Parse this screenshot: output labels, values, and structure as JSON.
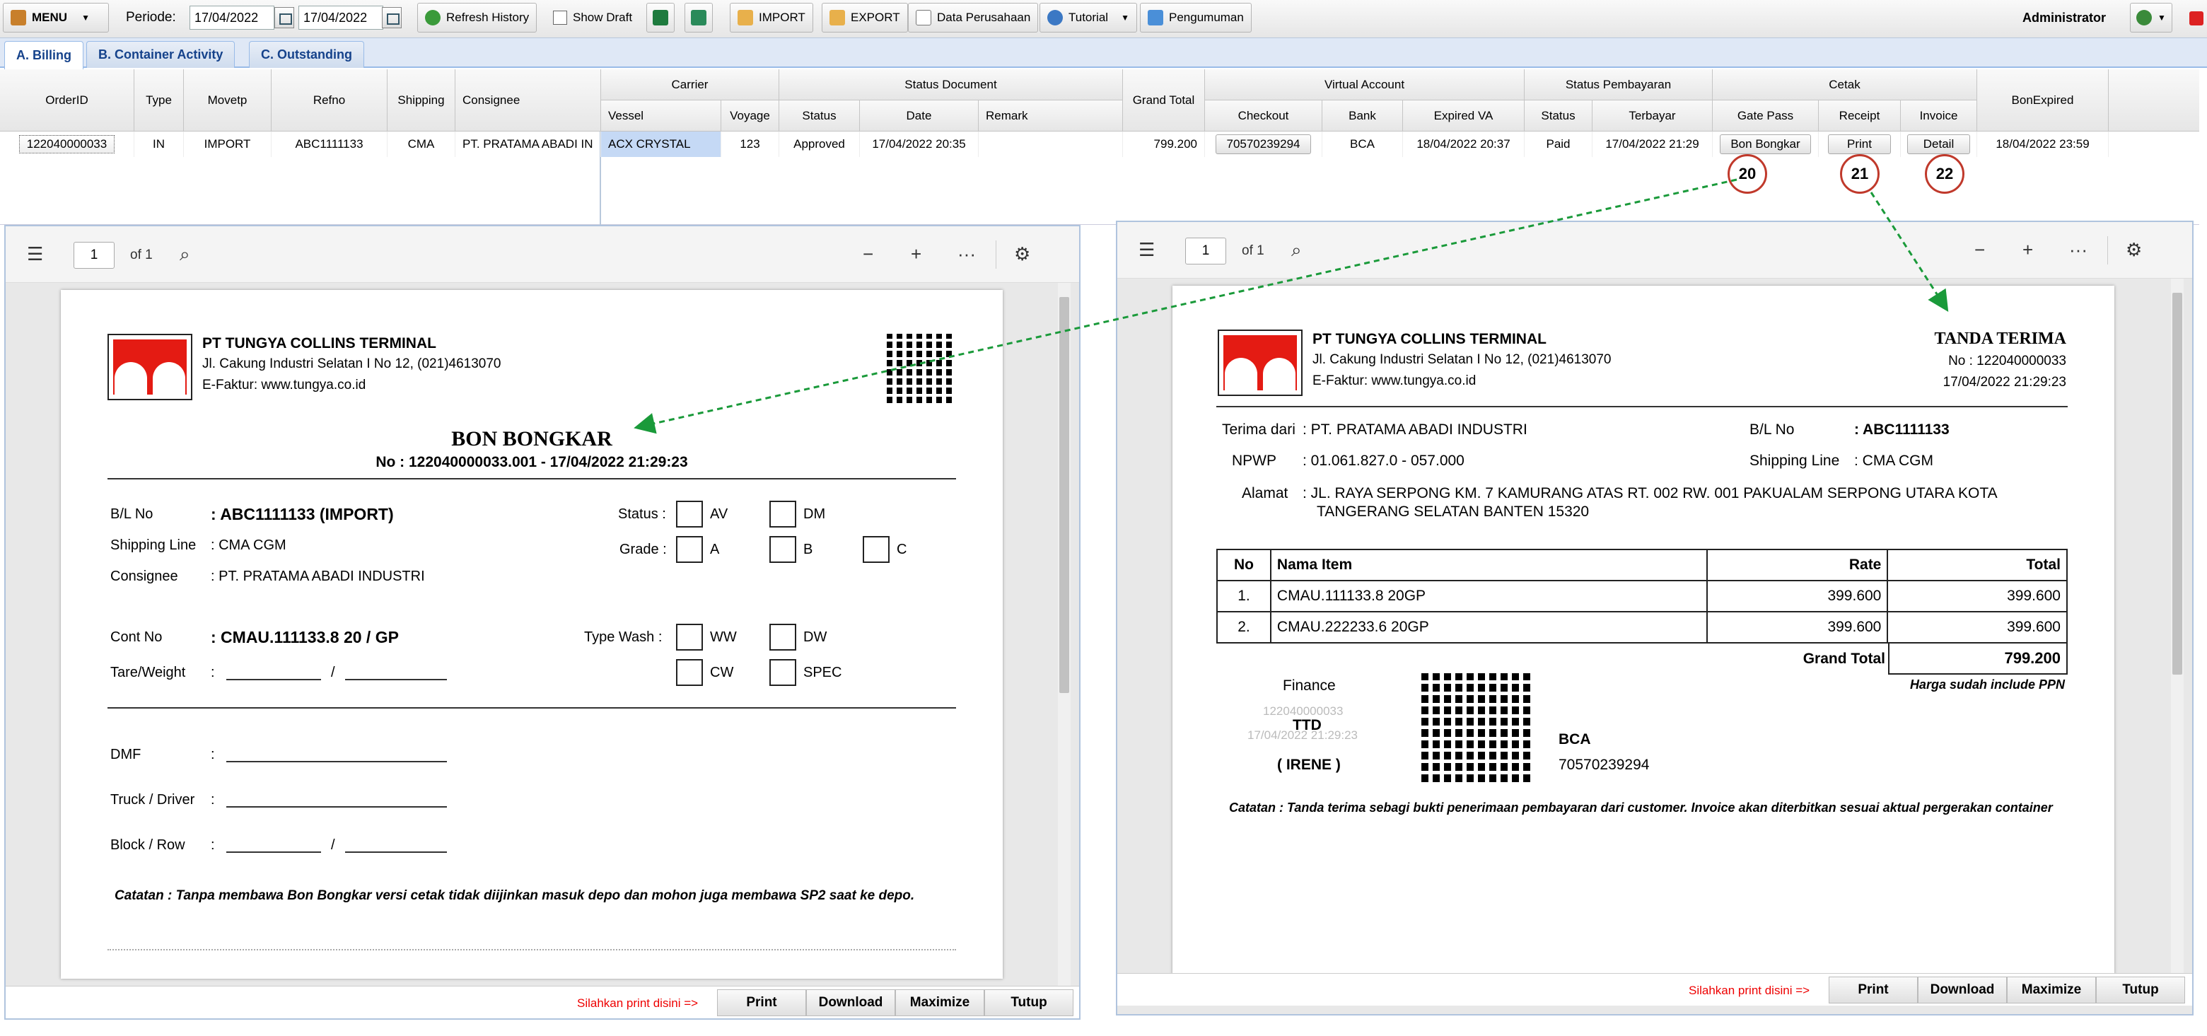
{
  "toolbar": {
    "menu_label": "MENU",
    "periode_label": "Periode:",
    "date_from": "17/04/2022",
    "date_to": "17/04/2022",
    "refresh_label": "Refresh History",
    "show_draft_label": "Show Draft",
    "import_label": "IMPORT",
    "export_label": "EXPORT",
    "data_perusahaan_label": "Data Perusahaan",
    "tutorial_label": "Tutorial",
    "pengumuman_label": "Pengumuman",
    "user_label": "Administrator"
  },
  "tabs": [
    "A. Billing",
    "B. Container Activity",
    "C. Outstanding"
  ],
  "grid": {
    "headers": {
      "orderid": "OrderID",
      "type": "Type",
      "movetp": "Movetp",
      "refno": "Refno",
      "shipping": "Shipping",
      "consignee": "Consignee",
      "carrier": "Carrier",
      "vessel": "Vessel",
      "voyage": "Voyage",
      "status_document": "Status Document",
      "status": "Status",
      "date": "Date",
      "remark": "Remark",
      "grand_total": "Grand Total",
      "virtual_account": "Virtual Account",
      "checkout": "Checkout",
      "bank": "Bank",
      "expired_va": "Expired VA",
      "status_pembayaran": "Status Pembayaran",
      "sp_status": "Status",
      "terbayar": "Terbayar",
      "cetak": "Cetak",
      "gate_pass": "Gate Pass",
      "receipt": "Receipt",
      "invoice": "Invoice",
      "bon_expired": "BonExpired"
    },
    "row": {
      "orderid": "122040000033",
      "type": "IN",
      "movetp": "IMPORT",
      "refno": "ABC1111133",
      "shipping": "CMA",
      "consignee": "PT. PRATAMA ABADI IN",
      "vessel": "ACX CRYSTAL",
      "voyage": "123",
      "status": "Approved",
      "date": "17/04/2022 20:35",
      "remark": "",
      "grand_total": "799.200",
      "checkout": "70570239294",
      "bank": "BCA",
      "expired_va": "18/04/2022 20:37",
      "sp_status": "Paid",
      "terbayar": "17/04/2022 21:29",
      "gate_pass": "Bon Bongkar",
      "receipt": "Print",
      "invoice": "Detail",
      "bon_expired": "18/04/2022 23:59"
    },
    "callouts": [
      "20",
      "21",
      "22"
    ]
  },
  "viewer_left": {
    "page": "1",
    "of": "of 1",
    "company": "PT TUNGYA COLLINS TERMINAL",
    "address": "Jl. Cakung Industri Selatan I No 12, (021)4613070",
    "efaktur": "E-Faktur: www.tungya.co.id",
    "title": "BON BONGKAR",
    "number": "No : 122040000033.001  -  17/04/2022 21:29:23",
    "bl_label": "B/L No",
    "bl_value": ": ABC1111133 (IMPORT)",
    "shipping_label": "Shipping Line",
    "shipping_value": ":  CMA CGM",
    "consignee_label": "Consignee",
    "consignee_value": ":  PT. PRATAMA ABADI INDUSTRI",
    "status_label": "Status :",
    "status_opts": [
      "AV",
      "DM"
    ],
    "grade_label": "Grade :",
    "grade_opts": [
      "A",
      "B",
      "C"
    ],
    "cont_label": "Cont No",
    "cont_value": ": CMAU.111133.8  20 / GP",
    "tare_label": "Tare/Weight",
    "colon": ":",
    "slash": "/",
    "typewash_label": "Type Wash :",
    "wash_opts": [
      "WW",
      "DW",
      "CW",
      "SPEC"
    ],
    "dmf_label": "DMF",
    "truck_label": "Truck / Driver",
    "block_label": "Block / Row",
    "catatan": "Catatan : Tanpa membawa Bon Bongkar versi cetak tidak diijinkan masuk depo dan mohon juga membawa SP2 saat ke depo.",
    "hint": "Silahkan print disini =>",
    "buttons": [
      "Print",
      "Download",
      "Maximize",
      "Tutup"
    ]
  },
  "viewer_right": {
    "page": "1",
    "of": "of 1",
    "company": "PT TUNGYA COLLINS TERMINAL",
    "address": "Jl. Cakung Industri Selatan I No 12, (021)4613070",
    "efaktur": "E-Faktur: www.tungya.co.id",
    "title": "TANDA TERIMA",
    "no": "No : 122040000033",
    "datetime": "17/04/2022 21:29:23",
    "terima_label": "Terima dari",
    "terima_value": ":  PT. PRATAMA ABADI INDUSTRI",
    "npwp_label": "NPWP",
    "npwp_value": ":  01.061.827.0 - 057.000",
    "alamat_label": "Alamat",
    "alamat_line1": ":  JL. RAYA SERPONG KM. 7 KAMURANG ATAS RT. 002 RW. 001 PAKUALAM SERPONG UTARA KOTA",
    "alamat_line2": "TANGERANG  SELATAN BANTEN 15320",
    "bl_label": "B/L No",
    "bl_value": ":  ABC1111133",
    "shipping_label": "Shipping Line",
    "shipping_value": ":  CMA CGM",
    "table_headers": [
      "No",
      "Nama Item",
      "Rate",
      "Total"
    ],
    "items": [
      {
        "no": "1.",
        "name": "CMAU.111133.8 20GP",
        "rate": "399.600",
        "total": "399.600"
      },
      {
        "no": "2.",
        "name": "CMAU.222233.6 20GP",
        "rate": "399.600",
        "total": "399.600"
      }
    ],
    "grand_total_label": "Grand Total",
    "grand_total": "799.200",
    "ppn_note": "Harga sudah include PPN",
    "finance": "Finance",
    "stamp_no": "122040000033",
    "stamp_date": "17/04/2022 21:29:23",
    "ttd": "TTD",
    "signer": "( IRENE )",
    "bank": "BCA",
    "va": "70570239294",
    "catatan": "Catatan : Tanda terima sebagi bukti penerimaan pembayaran dari customer. Invoice akan diterbitkan sesuai aktual pergerakan container",
    "hint": "Silahkan print disini =>",
    "buttons": [
      "Print",
      "Download",
      "Maximize",
      "Tutup"
    ]
  }
}
